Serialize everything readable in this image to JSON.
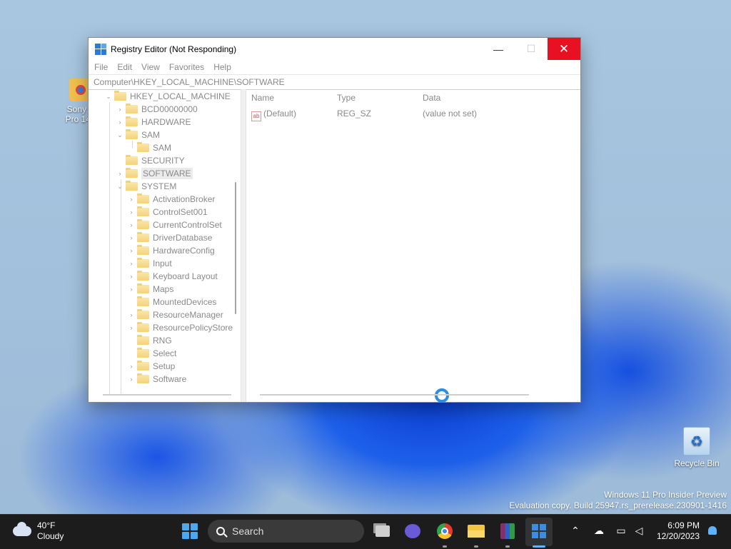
{
  "desktop": {
    "sony_icon_label": "Sony V\nPro 14 -",
    "recycle_bin_label": "Recycle Bin",
    "watermark_line1": "Windows 11 Pro Insider Preview",
    "watermark_line2": "Evaluation copy. Build 25947.rs_prerelease.230901-1416"
  },
  "window": {
    "title": "Registry Editor (Not Responding)",
    "minimize_glyph": "—",
    "maximize_glyph": "☐",
    "close_glyph": "✕",
    "menu": [
      "File",
      "Edit",
      "View",
      "Favorites",
      "Help"
    ],
    "address": "Computer\\HKEY_LOCAL_MACHINE\\SOFTWARE"
  },
  "tree": [
    {
      "label": "HKEY_LOCAL_MACHINE",
      "chevron": "⌄"
    },
    {
      "label": "BCD00000000",
      "chevron": "›"
    },
    {
      "label": "HARDWARE",
      "chevron": "›"
    },
    {
      "label": "SAM",
      "chevron": "⌄"
    },
    {
      "label": "SAM",
      "chevron": ""
    },
    {
      "label": "SECURITY",
      "chevron": ""
    },
    {
      "label": "SOFTWARE",
      "chevron": "›"
    },
    {
      "label": "SYSTEM",
      "chevron": "⌄"
    },
    {
      "label": "ActivationBroker",
      "chevron": "›"
    },
    {
      "label": "ControlSet001",
      "chevron": "›"
    },
    {
      "label": "CurrentControlSet",
      "chevron": "›"
    },
    {
      "label": "DriverDatabase",
      "chevron": "›"
    },
    {
      "label": "HardwareConfig",
      "chevron": "›"
    },
    {
      "label": "Input",
      "chevron": "›"
    },
    {
      "label": "Keyboard Layout",
      "chevron": "›"
    },
    {
      "label": "Maps",
      "chevron": "›"
    },
    {
      "label": "MountedDevices",
      "chevron": ""
    },
    {
      "label": "ResourceManager",
      "chevron": "›"
    },
    {
      "label": "ResourcePolicyStore",
      "chevron": "›"
    },
    {
      "label": "RNG",
      "chevron": ""
    },
    {
      "label": "Select",
      "chevron": ""
    },
    {
      "label": "Setup",
      "chevron": "›"
    },
    {
      "label": "Software",
      "chevron": "›"
    }
  ],
  "values": {
    "headers": {
      "name": "Name",
      "type": "Type",
      "data": "Data"
    },
    "rows": [
      {
        "icon": "ab",
        "name": "(Default)",
        "type": "REG_SZ",
        "data": "(value not set)"
      }
    ]
  },
  "taskbar": {
    "weather_temp": "40°F",
    "weather_desc": "Cloudy",
    "search_label": "Search",
    "tray_chevron": "⌃",
    "time": "6:09 PM",
    "date": "12/20/2023"
  }
}
